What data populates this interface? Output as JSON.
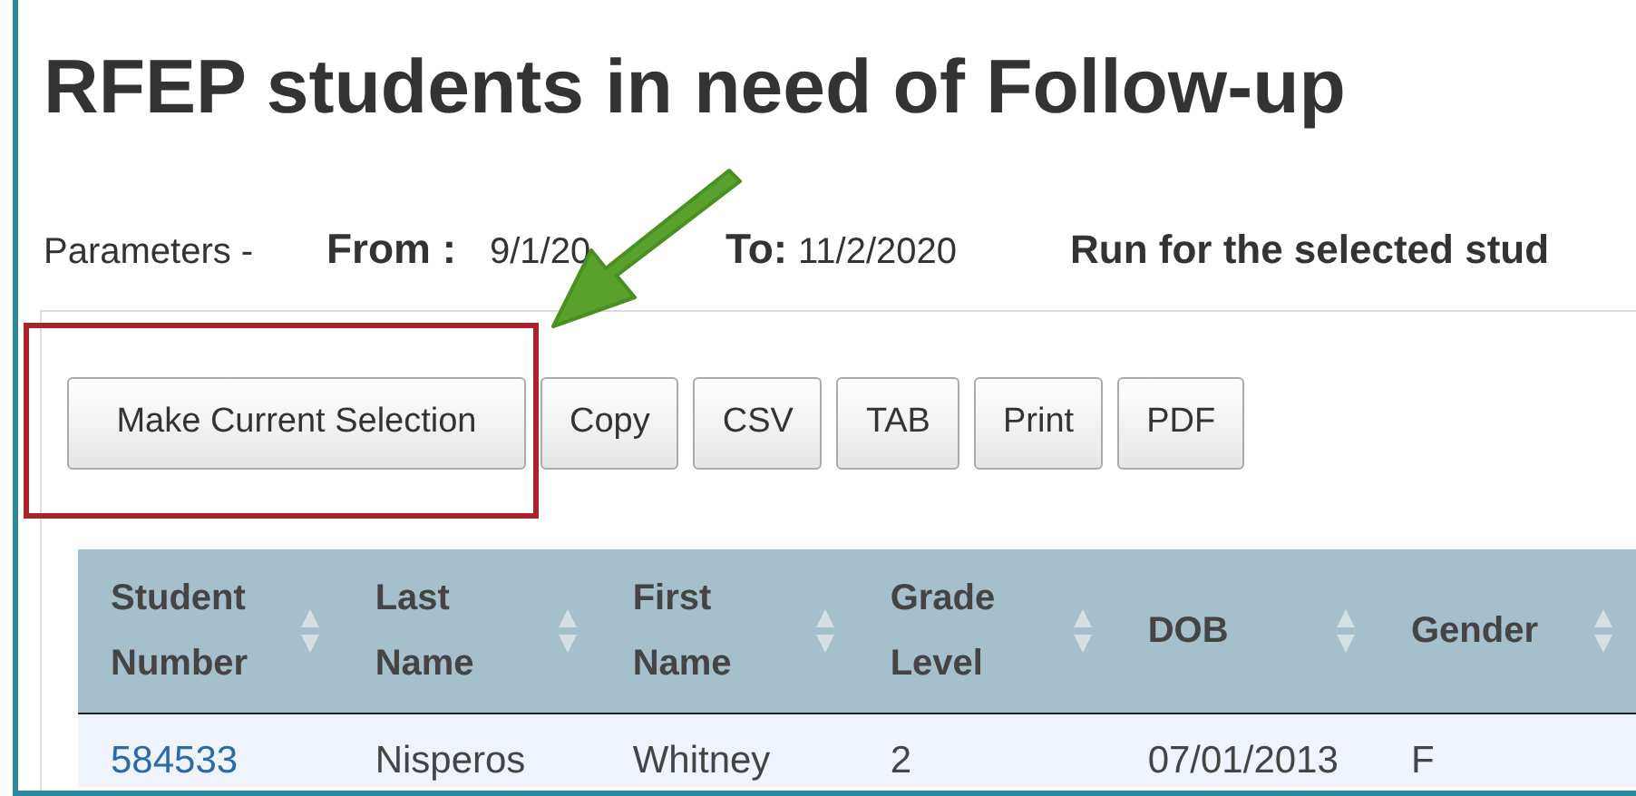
{
  "title": "RFEP students in need of Follow-up",
  "parameters": {
    "label": "Parameters -",
    "from_label": "From :",
    "from_value": "9/1/20",
    "to_label": "To:",
    "to_value": "11/2/2020",
    "run_for": "Run for the selected stud"
  },
  "buttons": [
    "Make Current Selection",
    "Copy",
    "CSV",
    "TAB",
    "Print",
    "PDF"
  ],
  "table": {
    "columns": [
      {
        "label": "Student Number"
      },
      {
        "label": "Last Name"
      },
      {
        "label": "First Name"
      },
      {
        "label": "Grade Level"
      },
      {
        "label": "DOB"
      },
      {
        "label": "Gender"
      }
    ],
    "rows": [
      {
        "cells": [
          "584533",
          "Nisperos",
          "Whitney",
          "2",
          "07/01/2013",
          "F"
        ]
      }
    ]
  }
}
